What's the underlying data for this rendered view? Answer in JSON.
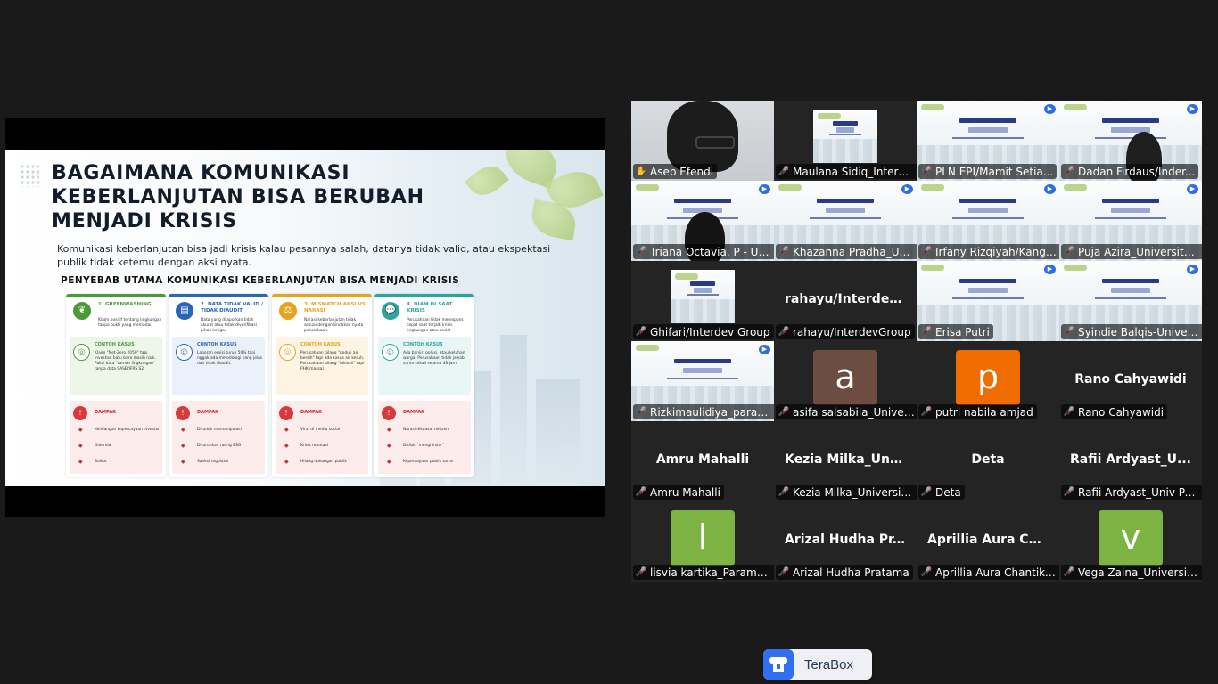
{
  "shared_slide": {
    "title": "BAGAIMANA KOMUNIKASI KEBERLANJUTAN BISA BERUBAH MENJADI KRISIS",
    "subtitle": "Komunikasi keberlanjutan bisa jadi krisis kalau pesannya salah, datanya tidak valid, atau ekspektasi publik tidak ketemu dengan aksi nyata.",
    "heading": "PENYEBAB UTAMA KOMUNIKASI KEBERLANJUTAN BISA MENJADI KRISIS",
    "columns": [
      {
        "title": "1. GREENWASHING",
        "desc": "Klaim positif tentang lingkungan tanpa bukti yang memadai.",
        "case_title": "CONTOH KASUS",
        "case_text": "Klaim \"Net-Zero 2050\" tapi investasi batu bara masih naik. Pakai kata \"ramah lingkungan\" tanpa data SASB/IFRS S2.",
        "impact_title": "DAMPAK",
        "impacts": [
          "Kehilangan kepercayaan investor",
          "Didenda",
          "Boikot"
        ],
        "color": "#4a9a3a"
      },
      {
        "title": "2. DATA TIDAK VALID / TIDAK DIAUDIT",
        "desc": "Data yang dilaporkan tidak akurat atau tidak diverifikasi pihak ketiga.",
        "case_title": "CONTOH KASUS",
        "case_text": "Laporan emisi turun 50% tapi nggak ada metodologi yang jelas dan tidak diaudit.",
        "impact_title": "DAMPAK",
        "impacts": [
          "Dituduh memanipulasi",
          "Diturunkan rating ESG",
          "Sanksi regulator"
        ],
        "color": "#2a66b8"
      },
      {
        "title": "3. MISMATCH AKSI VS NARASI",
        "desc": "Narasi keberlanjutan tidak sesuai dengan tindakan nyata perusahaan.",
        "case_title": "CONTOH KASUS",
        "case_text": "Perusahaan bilang \"peduli air bersih\" tapi ada kasus air keruh. Perusahaan bilang \"inklusif\" tapi PHK massal.",
        "impact_title": "DAMPAK",
        "impacts": [
          "Viral di media sosial",
          "Krisis reputasi",
          "Hilang dukungan publik"
        ],
        "color": "#e8a21c"
      },
      {
        "title": "4. DIAM DI SAAT KRISIS",
        "desc": "Perusahaan tidak merespons cepat saat terjadi krisis lingkungan atau sosial.",
        "case_title": "CONTOH KASUS",
        "case_text": "Ada banjir, polusi, atau keluhan warga. Perusahaan tidak jawab sama sekali selama 48 jam.",
        "impact_title": "DAMPAK",
        "impacts": [
          "Narasi dikuasai netizen",
          "Dicibir \"menghindar\"",
          "Kepercayaan publik turun"
        ],
        "color": "#2aa5a0"
      }
    ]
  },
  "participants": [
    {
      "name": "Asep Efendi",
      "muted": false,
      "type": "video",
      "active": true
    },
    {
      "name": "Maulana Sidiq_Interd...",
      "muted": true,
      "type": "slide-small"
    },
    {
      "name": "PLN EPI/Mamit Setia...",
      "muted": true,
      "type": "slide"
    },
    {
      "name": "Dadan Firdaus/Inder...",
      "muted": true,
      "type": "slide-person"
    },
    {
      "name": "Triana Octavia. P - Un...",
      "muted": true,
      "type": "slide-person-center"
    },
    {
      "name": "Khazanna Pradha_Uni...",
      "muted": true,
      "type": "slide"
    },
    {
      "name": "Irfany Rizqiyah/Kange...",
      "muted": true,
      "type": "slide"
    },
    {
      "name": "Puja Azira_Universitas...",
      "muted": true,
      "type": "slide"
    },
    {
      "name": "Ghifari/Interdev Group",
      "muted": true,
      "type": "slide-small"
    },
    {
      "name": "rahayu/InterdevGroup",
      "muted": true,
      "type": "name",
      "display": "rahayu/Interdev..."
    },
    {
      "name": "Erisa Putri",
      "muted": true,
      "type": "slide"
    },
    {
      "name": "Syindie Balqis-Univer...",
      "muted": true,
      "type": "slide"
    },
    {
      "name": "Rizkimaulidiya_param...",
      "muted": true,
      "type": "slide"
    },
    {
      "name": "asifa salsabila_Univer...",
      "muted": true,
      "type": "avatar",
      "letter": "a",
      "color": "#6d4c41"
    },
    {
      "name": "putri nabila amjad",
      "muted": true,
      "type": "avatar",
      "letter": "p",
      "color": "#ef6c00"
    },
    {
      "name": "Rano Cahyawidi",
      "muted": true,
      "type": "name",
      "display": "Rano Cahyawidi"
    },
    {
      "name": "Amru Mahalli",
      "muted": true,
      "type": "name",
      "display": "Amru Mahalli"
    },
    {
      "name": "Kezia Milka_Universit...",
      "muted": true,
      "type": "name",
      "display": "Kezia  Milka_Uni..."
    },
    {
      "name": "Deta",
      "muted": true,
      "type": "name",
      "display": "Deta"
    },
    {
      "name": "Rafii Ardyast_Univ Par...",
      "muted": true,
      "type": "name",
      "display": "Rafii  Ardyast_U..."
    },
    {
      "name": "lisvia kartika_Parama...",
      "muted": true,
      "type": "avatar",
      "letter": "l",
      "color": "#7cb342"
    },
    {
      "name": "Arizal Hudha Pratama",
      "muted": true,
      "type": "name",
      "display": "Arizal  Hudha  Pr..."
    },
    {
      "name": "Aprillia Aura Chantika...",
      "muted": true,
      "type": "name",
      "display": "Aprillia  Aura  Ch..."
    },
    {
      "name": "Vega Zaina_Universita...",
      "muted": true,
      "type": "avatar",
      "letter": "v",
      "color": "#7cb342"
    }
  ],
  "terabox": {
    "label": "TeraBox"
  },
  "colors": {
    "active_speaker": "#23d959",
    "muted": "#e02828",
    "background": "#1a1a1a"
  }
}
